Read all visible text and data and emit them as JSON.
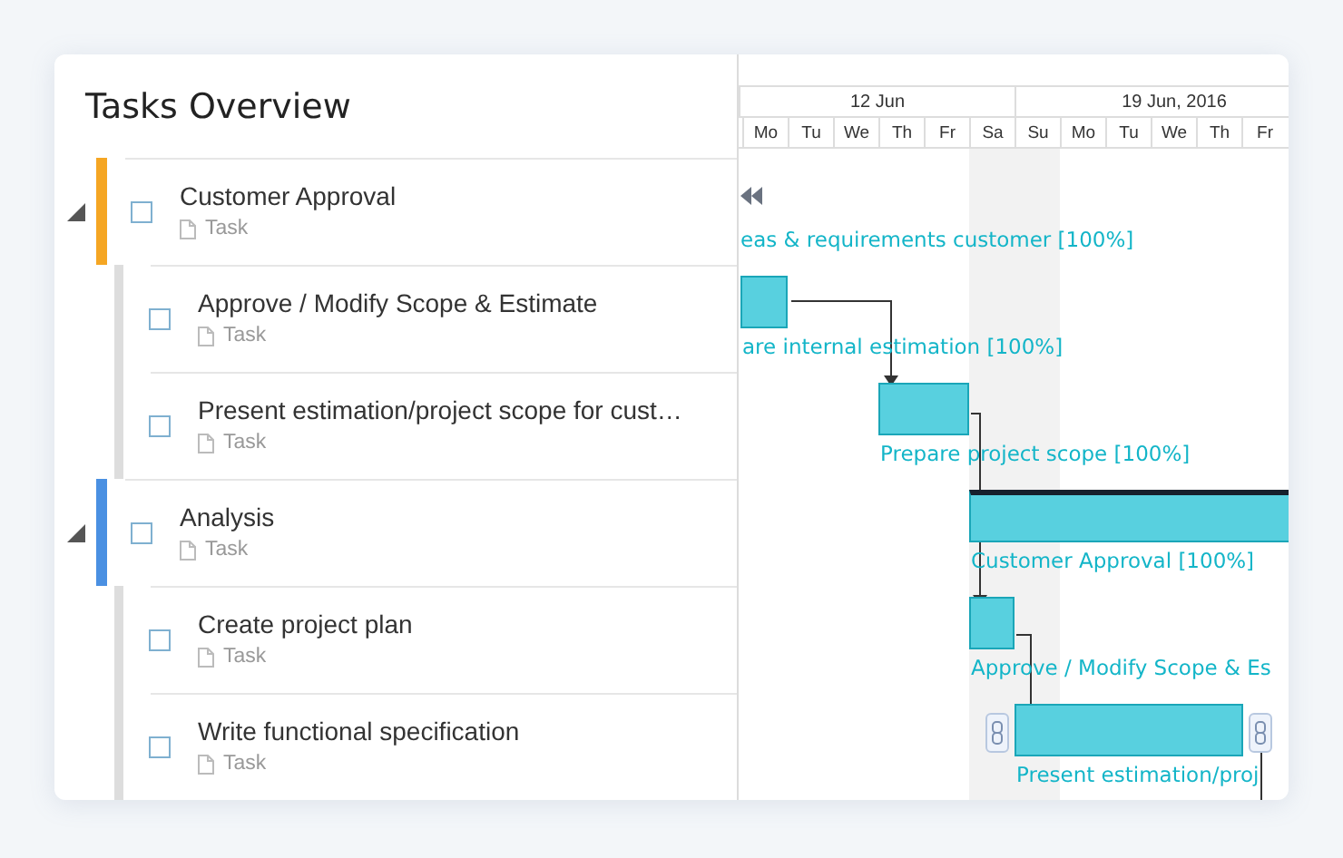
{
  "title": "Tasks Overview",
  "tasks": [
    {
      "name": "Customer Approval",
      "type": "Task",
      "color": "#f5a623",
      "expanded": true,
      "checked": false,
      "children": [
        {
          "name": "Approve / Modify Scope & Estimate",
          "type": "Task",
          "checked": false
        },
        {
          "name": "Present estimation/project scope for cust…",
          "type": "Task",
          "checked": false
        }
      ]
    },
    {
      "name": "Analysis",
      "type": "Task",
      "color": "#4a90e2",
      "expanded": true,
      "checked": false,
      "children": [
        {
          "name": "Create project plan",
          "type": "Task",
          "checked": false
        },
        {
          "name": "Write functional specification",
          "type": "Task",
          "checked": false
        }
      ]
    }
  ],
  "timeline": {
    "weeks": [
      "12 Jun",
      "19 Jun, 2016"
    ],
    "days": [
      {
        "label": "Mo",
        "weekend": false
      },
      {
        "label": "Tu",
        "weekend": false
      },
      {
        "label": "We",
        "weekend": false
      },
      {
        "label": "Th",
        "weekend": false
      },
      {
        "label": "Fr",
        "weekend": false
      },
      {
        "label": "Sa",
        "weekend": true
      },
      {
        "label": "Su",
        "weekend": true
      },
      {
        "label": "Mo",
        "weekend": false
      },
      {
        "label": "Tu",
        "weekend": false
      },
      {
        "label": "We",
        "weekend": false
      },
      {
        "label": "Th",
        "weekend": false
      },
      {
        "label": "Fr",
        "weekend": false
      }
    ],
    "bars": [
      {
        "kind": "offscreen",
        "label": "eas & requirements customer [100%]"
      },
      {
        "kind": "task",
        "label": "are internal estimation [100%]"
      },
      {
        "kind": "task",
        "label": "Prepare project scope [100%]"
      },
      {
        "kind": "summary",
        "label": "Customer Approval [100%]"
      },
      {
        "kind": "task",
        "label": "Approve / Modify Scope & Es"
      },
      {
        "kind": "linked",
        "label": "Present estimation/proj"
      }
    ]
  }
}
